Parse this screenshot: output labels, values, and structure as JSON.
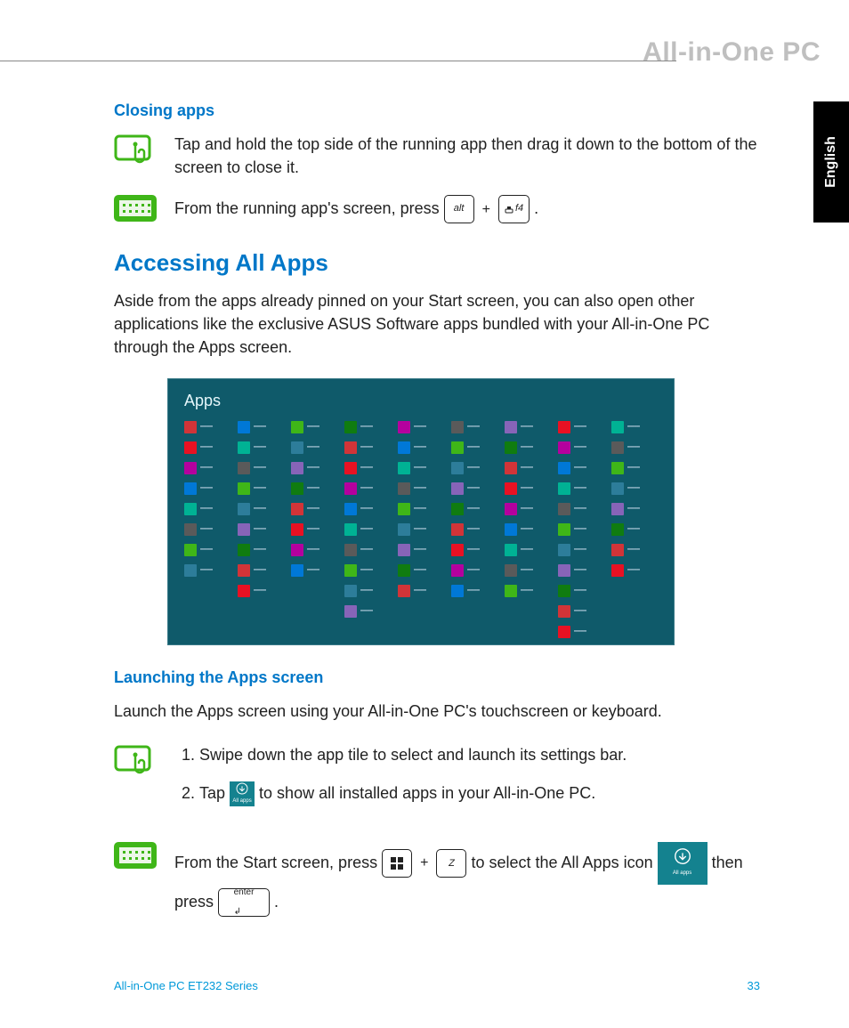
{
  "header": {
    "product_title": "All-in-One PC"
  },
  "language_tab": "English",
  "sections": {
    "closing_apps": {
      "heading": "Closing apps",
      "touch_text": "Tap and hold the top side of the running app then drag it down to the bottom of the screen to close it.",
      "kb_text_before": "From the running app's screen, press ",
      "kb_key1": "alt",
      "kb_plus": "+",
      "kb_key2": "f4",
      "kb_text_after": "."
    },
    "accessing": {
      "heading": "Accessing All Apps",
      "intro": "Aside from the apps already pinned on your Start screen, you can also open other applications like the exclusive ASUS Software apps bundled with your All-in-One PC through the Apps screen.",
      "screenshot_title": "Apps"
    },
    "launching": {
      "heading": "Launching the Apps screen",
      "intro": "Launch the Apps screen using your All-in-One PC's touchscreen or keyboard.",
      "touch_steps": [
        "Swipe down the app tile to select and launch its settings bar.",
        {
          "before": "Tap ",
          "after": " to show all installed apps in your All-in-One PC.",
          "tile_label": "All apps"
        }
      ],
      "kb": {
        "t1": "From the Start screen, press ",
        "plus": "+",
        "key_z": "Z",
        "t2": " to select the All Apps icon ",
        "tile_label": "All apps",
        "t3": " then press ",
        "key_enter": "enter",
        "t4": "."
      }
    }
  },
  "apps_grid_colors": [
    "#d13438",
    "#e81123",
    "#b4009e",
    "#0078d7",
    "#00b294",
    "#5a5a5a",
    "#3fb618",
    "#2d7d9a",
    "#8764b8",
    "#107c10"
  ],
  "footer": {
    "series": "All-in-One PC ET232 Series",
    "page": "33"
  }
}
